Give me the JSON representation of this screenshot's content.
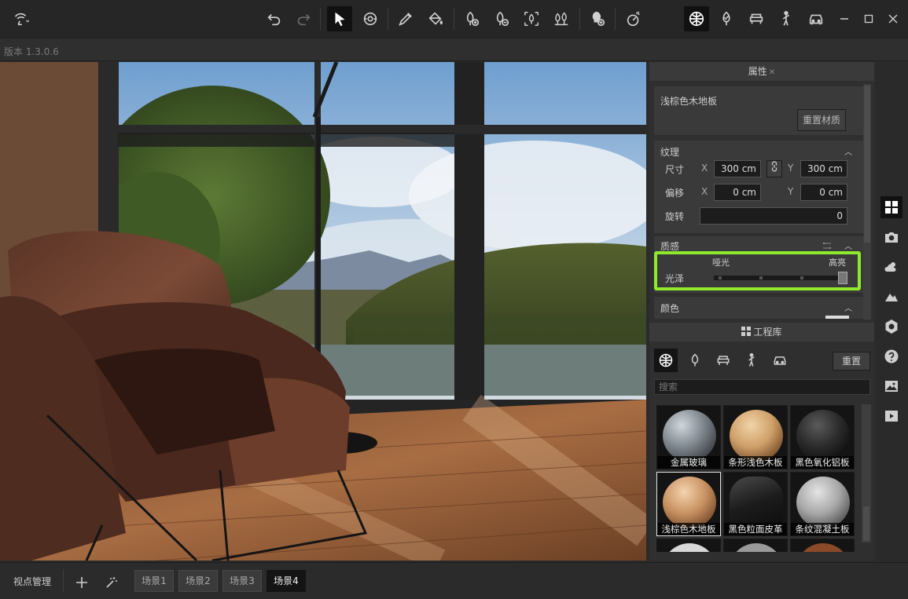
{
  "app": {
    "version": "版本 1.3.0.6"
  },
  "toolbar": {
    "icons": [
      "logo-icon",
      "undo-icon",
      "redo-icon",
      "select-icon",
      "orbit-icon",
      "eyedropper-icon",
      "paint-bucket-icon",
      "add-tree-icon",
      "remove-tree-icon",
      "scatter-tree-icon",
      "forest-icon",
      "add-light-icon",
      "effects-icon",
      "materials-library-icon",
      "plants-library-icon",
      "furniture-library-icon",
      "people-library-icon",
      "vehicles-library-icon"
    ],
    "window_controls": [
      "minimize",
      "maximize",
      "close"
    ]
  },
  "properties": {
    "tab_title": "属性",
    "material_name": "浅棕色木地板",
    "reset_material_label": "重置材质",
    "texture": {
      "title": "纹理",
      "size_label": "尺寸",
      "offset_label": "偏移",
      "rotation_label": "旋转",
      "x_axis": "X",
      "y_axis": "Y",
      "size_x": "300 cm",
      "size_y": "300 cm",
      "offset_x": "0 cm",
      "offset_y": "0 cm",
      "rotation": "0"
    },
    "quality": {
      "title": "质感",
      "gloss_label": "光泽",
      "matte_label": "哑光",
      "glossy_label": "高亮",
      "gloss_value": 1.0
    },
    "color": {
      "title": "颜色"
    }
  },
  "library": {
    "title": "工程库",
    "reset_label": "重置",
    "search_placeholder": "搜索",
    "categories": [
      "materials",
      "plants",
      "furniture",
      "people",
      "vehicles"
    ],
    "materials": [
      {
        "name": "金属玻璃",
        "selected": false
      },
      {
        "name": "条形浅色木板",
        "selected": false
      },
      {
        "name": "黑色氧化铝板",
        "selected": false
      },
      {
        "name": "浅棕色木地板",
        "selected": true
      },
      {
        "name": "黑色粒面皮革",
        "selected": false
      },
      {
        "name": "条纹混凝土板",
        "selected": false
      }
    ]
  },
  "side_tools": [
    "grid-view-icon",
    "camera-icon",
    "weather-icon",
    "terrain-icon",
    "settings-icon",
    "help-icon",
    "image-icon",
    "video-icon"
  ],
  "bottom": {
    "viewpoint_manager": "视点管理",
    "scenes": [
      "场景1",
      "场景2",
      "场景3",
      "场景4"
    ],
    "active_scene": "场景4"
  },
  "colors": {
    "highlight": "#8eea2b",
    "accent_dark": "#141414"
  }
}
